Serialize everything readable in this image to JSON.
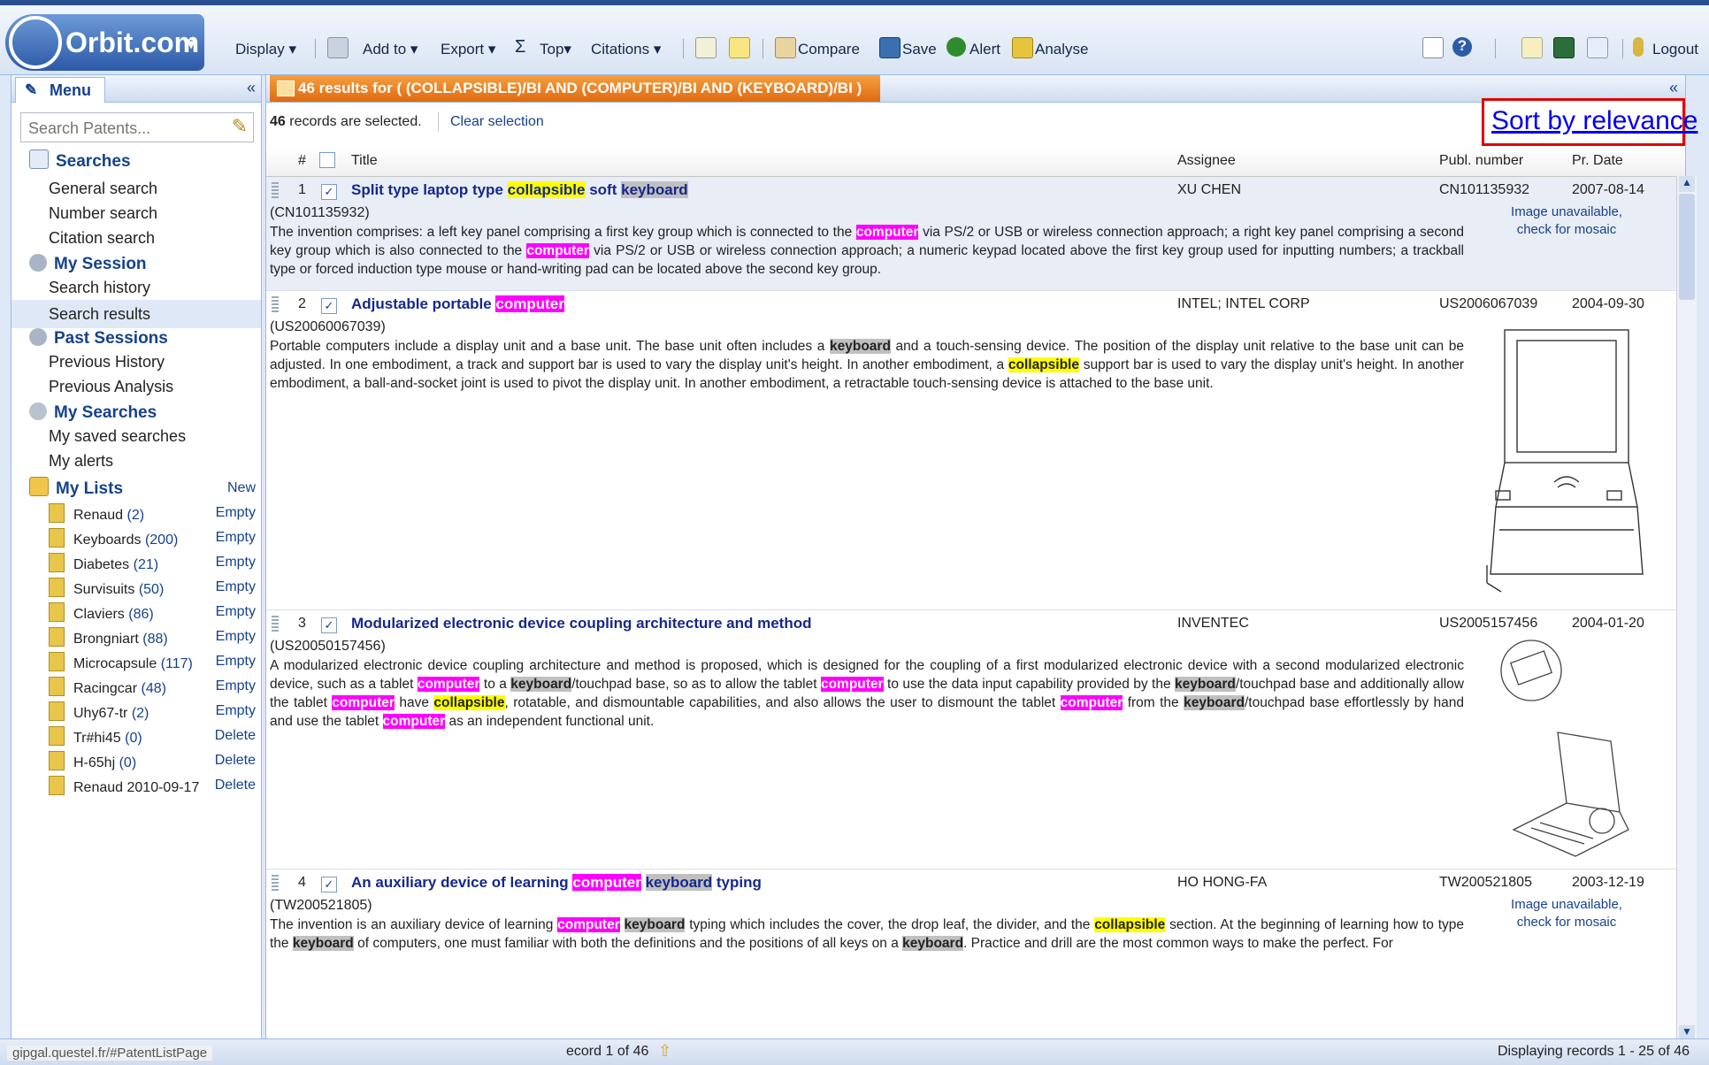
{
  "app": {
    "logo_text": "Orbit.com"
  },
  "toolbar": {
    "display": "Display",
    "add_to": "Add to",
    "export": "Export",
    "top": "Top",
    "citations": "Citations",
    "compare": "Compare",
    "save": "Save",
    "alert": "Alert",
    "analyse": "Analyse",
    "logout": "Logout"
  },
  "sidebar": {
    "menu_label": "Menu",
    "collapse": "«",
    "search_placeholder": "Search Patents...",
    "searches": {
      "title": "Searches",
      "items": [
        "General search",
        "Number search",
        "Citation search"
      ]
    },
    "my_session": {
      "title": "My Session",
      "items": [
        "Search history",
        "Search results"
      ]
    },
    "past_sessions": {
      "title": "Past Sessions",
      "items": [
        "Previous History",
        "Previous Analysis"
      ]
    },
    "my_searches": {
      "title": "My Searches",
      "items": [
        "My saved searches",
        "My alerts"
      ]
    },
    "my_lists": {
      "title": "My Lists",
      "new_label": "New",
      "lists": [
        {
          "name": "Renaud",
          "count": "(2)",
          "action": "Empty"
        },
        {
          "name": "Keyboards",
          "count": "(200)",
          "action": "Empty"
        },
        {
          "name": "Diabetes",
          "count": "(21)",
          "action": "Empty"
        },
        {
          "name": "Survisuits",
          "count": "(50)",
          "action": "Empty"
        },
        {
          "name": "Claviers",
          "count": "(86)",
          "action": "Empty"
        },
        {
          "name": "Brongniart",
          "count": "(88)",
          "action": "Empty"
        },
        {
          "name": "Microcapsule",
          "count": "(117)",
          "action": "Empty"
        },
        {
          "name": "Racingcar",
          "count": "(48)",
          "action": "Empty"
        },
        {
          "name": "Uhy67-tr",
          "count": "(2)",
          "action": "Empty"
        },
        {
          "name": "Tr#hi45",
          "count": "(0)",
          "action": "Delete"
        },
        {
          "name": "H-65hj",
          "count": "(0)",
          "action": "Delete"
        },
        {
          "name": "Renaud 2010-09-17",
          "count": "",
          "action": "Delete"
        }
      ]
    }
  },
  "results": {
    "tab_title": "46 results for ( (COLLAPSIBLE)/BI AND (COMPUTER)/BI AND (KEYBOARD)/BI )",
    "selected_count": "46",
    "selected_text": "records are selected.",
    "clear_selection": "Clear selection",
    "sort_link": "Sort by relevance",
    "columns": {
      "num": "#",
      "title": "Title",
      "assignee": "Assignee",
      "pubno": "Publ. number",
      "prdate": "Pr. Date"
    },
    "records": [
      {
        "num": "1",
        "title": "Split type laptop type collapsible soft keyboard",
        "assignee": "XU CHEN",
        "pub": "CN101135932",
        "date": "2007-08-14",
        "pid": "(CN101135932)",
        "image_na": [
          "Image unavailable,",
          "check for mosaic"
        ],
        "abstract": "The invention comprises: a left key panel comprising a first key group which is connected to the computer via PS/2 or USB or wireless connection approach; a right key panel comprising a second key group which is also connected to the computer via PS/2 or USB or wireless connection approach; a numeric keypad located above the first key group used for inputting numbers; a trackball type or forced induction type mouse or hand-writing pad can be located above the second key group."
      },
      {
        "num": "2",
        "title": "Adjustable portable computer",
        "assignee": "INTEL; INTEL CORP",
        "pub": "US2006067039",
        "date": "2004-09-30",
        "pid": "(US20060067039)",
        "abstract": "Portable computers include a display unit and a base unit. The base unit often includes a keyboard and a touch-sensing device. The position of the display unit relative to the base unit can be adjusted. In one embodiment, a track and support bar is used to vary the display unit's height. In another embodiment, a collapsible support bar is used to vary the display unit's height. In another embodiment, a ball-and-socket joint is used to pivot the display unit. In another embodiment, a retractable touch-sensing device is attached to the base unit."
      },
      {
        "num": "3",
        "title": "Modularized electronic device coupling architecture and method",
        "assignee": "INVENTEC",
        "pub": "US2005157456",
        "date": "2004-01-20",
        "pid": "(US20050157456)",
        "abstract": "A modularized electronic device coupling architecture and method is proposed, which is designed for the coupling of a first modularized electronic device with a second modularized electronic device, such as a tablet computer to a keyboard/touchpad base, so as to allow the tablet computer to use the data input capability provided by the keyboard/touchpad base and additionally allow the tablet computer have collapsible, rotatable, and dismountable capabilities, and also allows the user to dismount the tablet computer from the keyboard/touchpad base effortlessly by hand and use the tablet computer as an independent functional unit."
      },
      {
        "num": "4",
        "title": "An auxiliary device of learning computer keyboard typing",
        "assignee": "HO HONG-FA",
        "pub": "TW200521805",
        "date": "2003-12-19",
        "pid": "(TW200521805)",
        "image_na": [
          "Image unavailable,",
          "check for mosaic"
        ],
        "abstract": "The invention is an auxiliary device of learning computer keyboard typing which includes the cover, the drop leaf, the divider, and the collapsible section. At the beginning of learning how to type the keyboard of computers, one must familiar with both the definitions and the positions of all keys on a keyboard. Practice and drill are the most common ways to make the perfect. For"
      }
    ]
  },
  "status": {
    "url": "gipgal.questel.fr/#PatentListPage",
    "record_info": "ecord 1 of 46",
    "display_info": "Displaying records 1 - 25 of 46"
  }
}
